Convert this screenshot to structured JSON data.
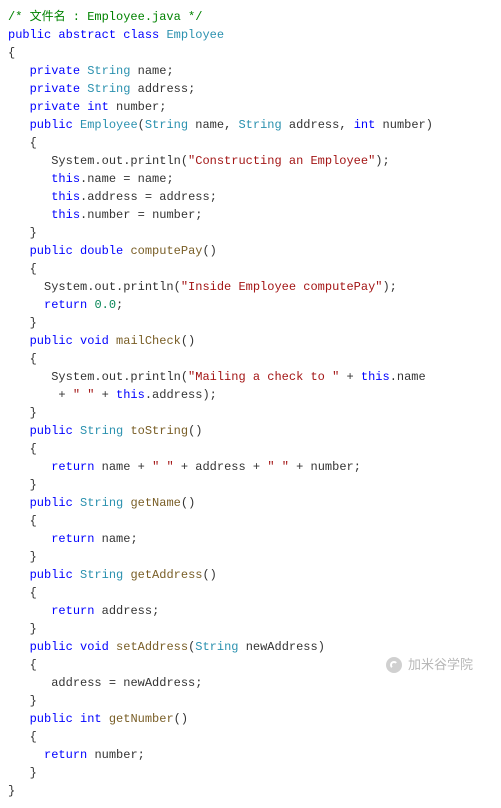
{
  "code": {
    "c1": "/* 文件名 : Employee.java */",
    "kw_public": "public",
    "kw_abstract": "abstract",
    "kw_class": "class",
    "kw_private": "private",
    "kw_double": "double",
    "kw_void": "void",
    "kw_int": "int",
    "kw_return": "return",
    "kw_this": "this",
    "cls_Employee": "Employee",
    "cls_String": "String",
    "id_name": "name",
    "id_address": "address",
    "id_number": "number",
    "id_newAddress": "newAddress",
    "m_computePay": "computePay",
    "m_mailCheck": "mailCheck",
    "m_toString": "toString",
    "m_getName": "getName",
    "m_getAddress": "getAddress",
    "m_setAddress": "setAddress",
    "m_getNumber": "getNumber",
    "call_sysout": "System.out.println",
    "str_construct": "\"Constructing an Employee\"",
    "str_inside": "\"Inside Employee computePay\"",
    "str_mailing": "\"Mailing a check to \"",
    "str_space": "\" \"",
    "num_zero": "0.0"
  },
  "watermark": "加米谷学院"
}
